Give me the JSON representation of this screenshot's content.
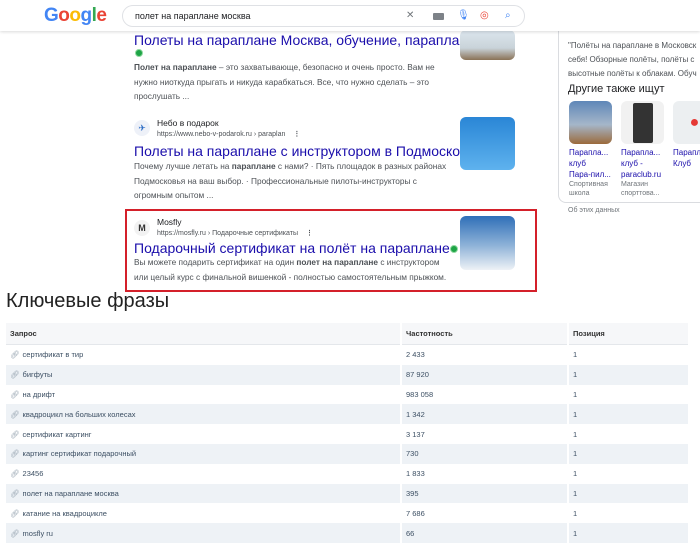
{
  "header": {
    "logo": "Google",
    "query": "полет на параплане москва"
  },
  "results": [
    {
      "title": "Полеты на параплане Москва, обучение, параплан, цена",
      "snippet_bold": "Полет на параплане",
      "snippet": " – это захватывающе, безопасно и очень просто. Вам не нужно ниоткуда прыгать и никуда карабкаться. Все, что нужно сделать – это прослушать ..."
    },
    {
      "site": "Небо в подарок",
      "url": "https://www.nebo-v-podarok.ru › paraplan",
      "title": "Полеты на параплане с инструктором в Подмосковье",
      "snippet_pre": "Почему лучше летать на ",
      "snippet_bold": "параплане",
      "snippet": " с нами? · Пять площадок в разных районах Подмосковья на ваш выбор. · Профессиональные пилоты-инструкторы с огромным опытом ..."
    },
    {
      "site": "Mosfly",
      "url": "https://mosfly.ru › Подарочные сертификаты",
      "title": "Подарочный сертификат на полёт на параплане",
      "snippet_pre": "Вы можете подарить сертификат на один ",
      "snippet_bold": "полет на параплане",
      "snippet": " с инструктором или целый курс с финальной вишенкой - полностью самостоятельным прыжком."
    }
  ],
  "panel": {
    "lines": [
      "\"Полёты на параплане в Московск",
      "себя! Обзорные полёты, полёты с",
      "высотные полёты к облакам. Обуч"
    ],
    "also_title": "Другие также ищут",
    "cards": [
      {
        "l1": "Парапла...",
        "l2": "клуб",
        "l3": "Пара-пил...",
        "s1": "Спортивная",
        "s2": "школа"
      },
      {
        "l1": "Парапла...",
        "l2": "клуб -",
        "l3": "paraclub.ru",
        "s1": "Магазин",
        "s2": "спорттова..."
      },
      {
        "l1": "Парапл",
        "l2": "Клуб",
        "l3": "",
        "s1": "",
        "s2": ""
      }
    ],
    "about": "Об этих данных"
  },
  "keywords": {
    "title": "Ключевые фразы",
    "headers": [
      "Запрос",
      "Частотность",
      "Позиция"
    ],
    "rows": [
      [
        "сертификат в тир",
        "2 433",
        "1"
      ],
      [
        "бигфуты",
        "87 920",
        "1"
      ],
      [
        "на дрифт",
        "983 058",
        "1"
      ],
      [
        "квадроцикл на больших колесах",
        "1 342",
        "1"
      ],
      [
        "сертификат картинг",
        "3 137",
        "1"
      ],
      [
        "картинг сертификат подарочный",
        "730",
        "1"
      ],
      [
        "23456",
        "1 833",
        "1"
      ],
      [
        "полет на параплане москва",
        "395",
        "1"
      ],
      [
        "катание на квадроцикле",
        "7 686",
        "1"
      ],
      [
        "mosfly ru",
        "66",
        "1"
      ]
    ]
  }
}
